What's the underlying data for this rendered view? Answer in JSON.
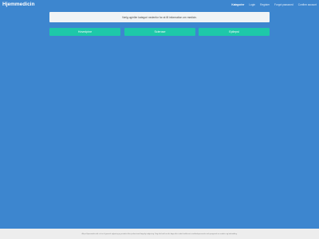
{
  "navbar": {
    "brand": "Hjemmedicin",
    "links": [
      {
        "label": "Kategorier",
        "active": true
      },
      {
        "label": "Login",
        "active": false
      },
      {
        "label": "Register",
        "active": false
      },
      {
        "label": "Forgot password",
        "active": false
      },
      {
        "label": "Confirm account",
        "active": false
      }
    ]
  },
  "info": {
    "text": "Vælg og/eller kategori nedenfor for at få information om medicin."
  },
  "categories": [
    {
      "label": "Hovedpine"
    },
    {
      "label": "Sclerose"
    },
    {
      "label": "Epilepsi"
    }
  ],
  "footer": {
    "text": "Alt på Hjemmedicin.dk er kun til generel oplysning og erstatter ikke professionel lægelig rådgivning. Søg altid råd hos din læge eller andet kvalificeret sundhedspersonale ved spørgsmål om medicin og behandling."
  },
  "colors": {
    "background": "#3d86cf",
    "button": "#1ec8a9",
    "info_box": "#f1f4f6",
    "footer": "#ededed"
  }
}
